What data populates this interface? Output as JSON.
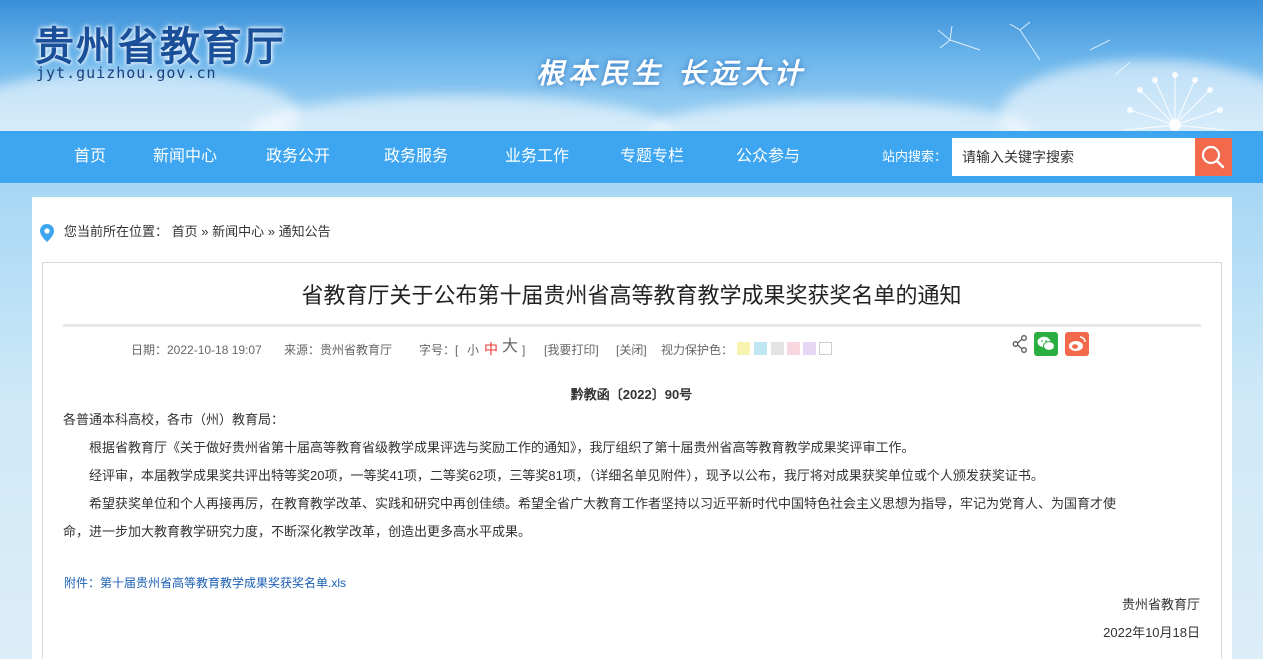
{
  "header": {
    "site_title": "贵州省教育厅",
    "site_domain": "jyt.guizhou.gov.cn",
    "slogan": "根本民生 长远大计"
  },
  "nav": {
    "items": [
      {
        "label": "首页"
      },
      {
        "label": "新闻中心"
      },
      {
        "label": "政务公开"
      },
      {
        "label": "政务服务"
      },
      {
        "label": "业务工作"
      },
      {
        "label": "专题专栏"
      },
      {
        "label": "公众参与"
      }
    ],
    "search_label": "站内搜索：",
    "search_placeholder": "请输入关键字搜索",
    "search_icon": "search-icon"
  },
  "breadcrumb": {
    "prefix": "您当前所在位置：",
    "items": [
      "首页",
      "新闻中心",
      "通知公告"
    ],
    "separator": "»"
  },
  "article": {
    "title": "省教育厅关于公布第十届贵州省高等教育教学成果奖获奖名单的通知",
    "meta": {
      "date": "日期：2022-10-18 19:07",
      "source": "来源：贵州省教育厅",
      "font_size_label": "字号：[",
      "font_small": "小",
      "font_medium": "中",
      "font_large": "大",
      "font_close": "]",
      "print": "[我要打印]",
      "close": "[关闭]",
      "eye_care": "视力保护色："
    },
    "eye_care_colors": [
      "#f9f3b0",
      "#bfe6f3",
      "#e3e3e3",
      "#f8d7e0",
      "#e6d7f4",
      "#ffffff"
    ],
    "doc_number": "黔教函〔2022〕90号",
    "salutation": "各普通本科高校，各市（州）教育局：",
    "paragraphs": [
      "根据省教育厅《关于做好贵州省第十届高等教育省级教学成果评选与奖励工作的通知》，我厅组织了第十届贵州省高等教育教学成果奖评审工作。",
      "经评审，本届教学成果奖共评出特等奖20项，一等奖41项，二等奖62项，三等奖81项，（详细名单见附件），现予以公布，我厅将对成果获奖单位或个人颁发获奖证书。",
      "希望获奖单位和个人再接再厉，在教育教学改革、实践和研究中再创佳绩。希望全省广大教育工作者坚持以习近平新时代中国特色社会主义思想为指导，牢记为党育人、为国育才使",
      "命，进一步加大教育教学研究力度，不断深化教学改革，创造出更多高水平成果。"
    ],
    "attachment": "附件：第十届贵州省高等教育教学成果奖获奖名单.xls",
    "signature": "贵州省教育厅",
    "sign_date": "2022年10月18日"
  },
  "colors": {
    "nav_bg": "#3ea6f0",
    "search_btn": "#f26a4b",
    "wechat": "#2aae3f",
    "weibo": "#f26a4b",
    "link": "#1a5fb4"
  }
}
